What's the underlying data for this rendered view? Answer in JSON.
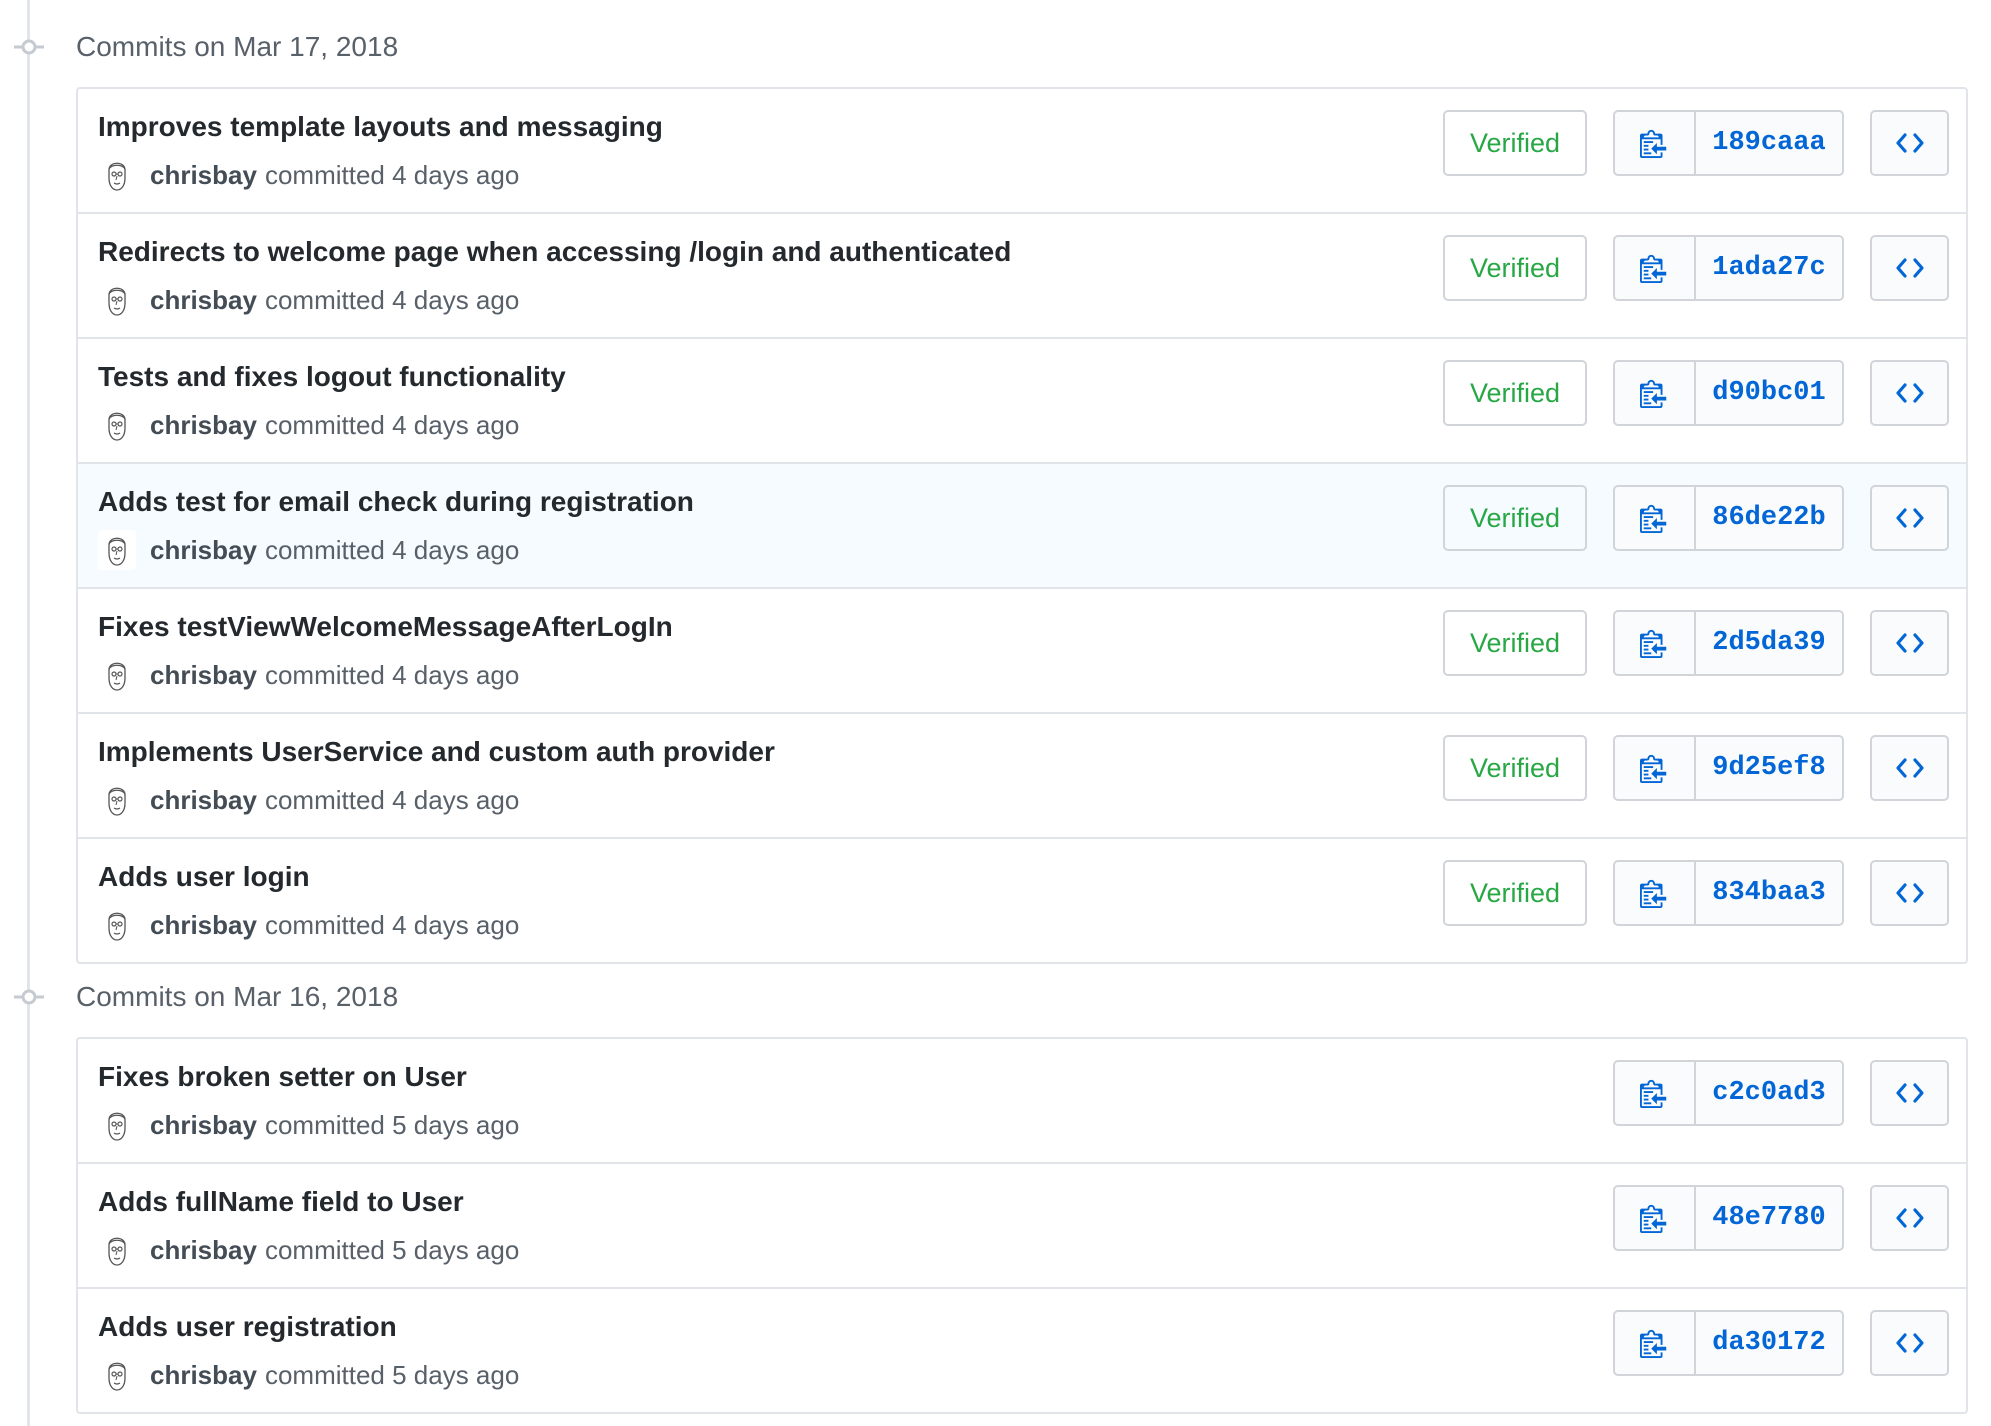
{
  "groups": [
    {
      "title": "Commits on Mar 17, 2018",
      "commits": [
        {
          "message": "Improves template layouts and messaging",
          "author": "chrisbay",
          "meta": "committed 4 days ago",
          "verified": "Verified",
          "sha": "189caaa"
        },
        {
          "message": "Redirects to welcome page when accessing /login and authenticated",
          "author": "chrisbay",
          "meta": "committed 4 days ago",
          "verified": "Verified",
          "sha": "1ada27c"
        },
        {
          "message": "Tests and fixes logout functionality",
          "author": "chrisbay",
          "meta": "committed 4 days ago",
          "verified": "Verified",
          "sha": "d90bc01"
        },
        {
          "message": "Adds test for email check during registration",
          "author": "chrisbay",
          "meta": "committed 4 days ago",
          "verified": "Verified",
          "sha": "86de22b"
        },
        {
          "message": "Fixes testViewWelcomeMessageAfterLogIn",
          "author": "chrisbay",
          "meta": "committed 4 days ago",
          "verified": "Verified",
          "sha": "2d5da39"
        },
        {
          "message": "Implements UserService and custom auth provider",
          "author": "chrisbay",
          "meta": "committed 4 days ago",
          "verified": "Verified",
          "sha": "9d25ef8"
        },
        {
          "message": "Adds user login",
          "author": "chrisbay",
          "meta": "committed 4 days ago",
          "verified": "Verified",
          "sha": "834baa3"
        }
      ]
    },
    {
      "title": "Commits on Mar 16, 2018",
      "commits": [
        {
          "message": "Fixes broken setter on User",
          "author": "chrisbay",
          "meta": "committed 5 days ago",
          "verified": "",
          "sha": "c2c0ad3"
        },
        {
          "message": "Adds fullName field to User",
          "author": "chrisbay",
          "meta": "committed 5 days ago",
          "verified": "",
          "sha": "48e7780"
        },
        {
          "message": "Adds user registration",
          "author": "chrisbay",
          "meta": "committed 5 days ago",
          "verified": "",
          "sha": "da30172"
        }
      ]
    }
  ],
  "icons": {
    "timeline": "commit-node-icon",
    "avatar": "avatar-sketch-icon",
    "copy": "clipboard-icon",
    "browse": "code-icon"
  },
  "colors": {
    "verified": "#28a745",
    "sha": "#0366d6",
    "hover_row": "#f6fbff"
  },
  "hovered_row": {
    "group": 0,
    "commit": 3
  }
}
